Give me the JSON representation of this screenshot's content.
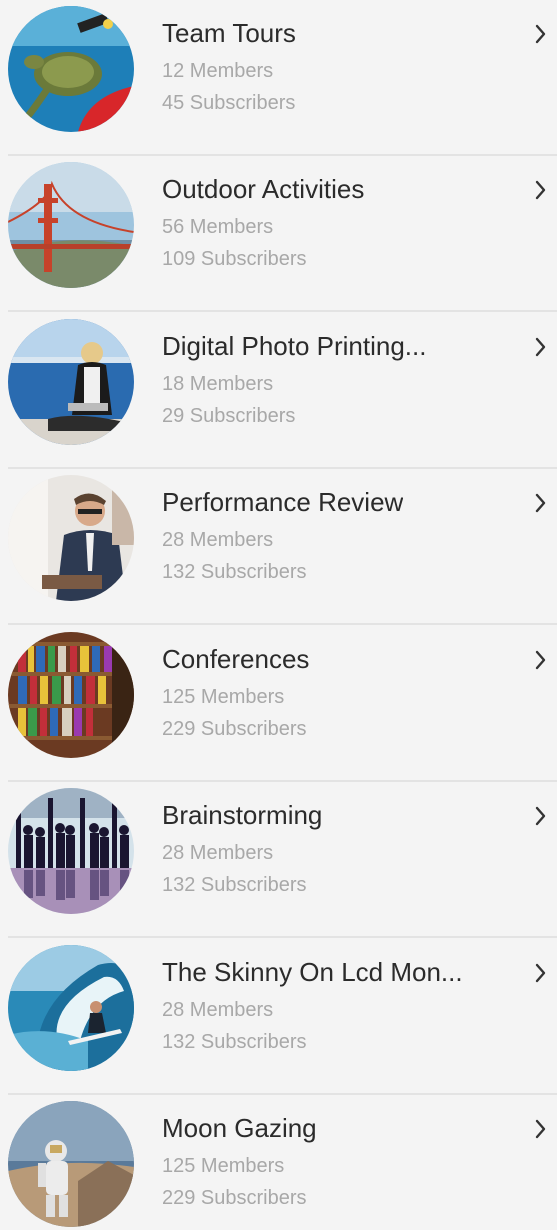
{
  "groups": [
    {
      "title": "Team Tours",
      "members": "12 Members",
      "subscribers": "45 Subscribers",
      "image": "sea-turtle-diver"
    },
    {
      "title": "Outdoor Activities",
      "members": "56 Members",
      "subscribers": "109 Subscribers",
      "image": "golden-gate-bridge"
    },
    {
      "title": "Digital Photo Printing...",
      "members": "18 Members",
      "subscribers": "29 Subscribers",
      "image": "woman-with-tablet"
    },
    {
      "title": "Performance Review",
      "members": "28 Members",
      "subscribers": "132 Subscribers",
      "image": "businessman-at-desk"
    },
    {
      "title": "Conferences",
      "members": "125 Members",
      "subscribers": "229 Subscribers",
      "image": "library-bookshelves"
    },
    {
      "title": "Brainstorming",
      "members": "28 Members",
      "subscribers": "132 Subscribers",
      "image": "people-silhouettes"
    },
    {
      "title": "The Skinny On Lcd Mon...",
      "members": "28 Members",
      "subscribers": "132 Subscribers",
      "image": "surfer-wave"
    },
    {
      "title": "Moon Gazing",
      "members": "125 Members",
      "subscribers": "229 Subscribers",
      "image": "astronaut"
    }
  ],
  "colors": {
    "background": "#f4f4f4",
    "title": "#2b2b2b",
    "meta": "#a8a8a8",
    "divider": "#e3e3e3",
    "chevron": "#333333"
  },
  "icons": {
    "chevron": "chevron-right-icon"
  }
}
